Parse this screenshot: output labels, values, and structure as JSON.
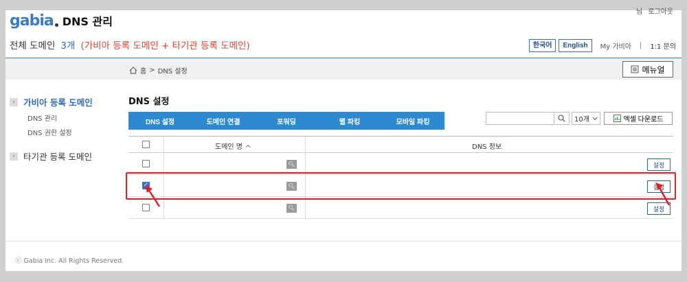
{
  "header": {
    "logo_text": "gabia",
    "app_title": "DNS 관리",
    "user_name": "님",
    "logout_label": "로그아웃"
  },
  "summary": {
    "label": "전체 도메인",
    "count": "3개",
    "note": "(가비아 등록 도메인 + 타기관 등록 도메인)"
  },
  "nav": {
    "lang_korean": "한국어",
    "lang_english": "English",
    "my_gabia": "My 가비아",
    "separator": "|",
    "inquiry": "1:1 문의"
  },
  "breadcrumb": {
    "home": "홈",
    "sep": ">",
    "current": "DNS 설정"
  },
  "manual_label": "메뉴얼",
  "sidebar": {
    "groups": [
      {
        "label": "가비아 등록 도메인",
        "items": [
          "DNS 관리",
          "DNS 권한 설정"
        ]
      },
      {
        "label": "타기관 등록 도메인"
      }
    ]
  },
  "main": {
    "title": "DNS 설정",
    "toolbar": [
      "DNS 설정",
      "도메인 연결",
      "포워딩",
      "웹 파킹",
      "모바일 파킹"
    ],
    "page_size": "10개",
    "excel_label": "엑셀 다운로드"
  },
  "table": {
    "headers": {
      "domain": "도메인 명",
      "dns": "DNS 정보"
    },
    "rows": [
      {
        "checked": false,
        "button": "설정"
      },
      {
        "checked": true,
        "button": "설정"
      },
      {
        "checked": false,
        "button": "설정"
      }
    ]
  },
  "footer": "ⓒ Gabia Inc. All Rights Reserved.",
  "colors": {
    "accent": "#2d8ad1",
    "highlight": "#e02020",
    "link": "#2f6db8",
    "note": "#e0412f"
  }
}
